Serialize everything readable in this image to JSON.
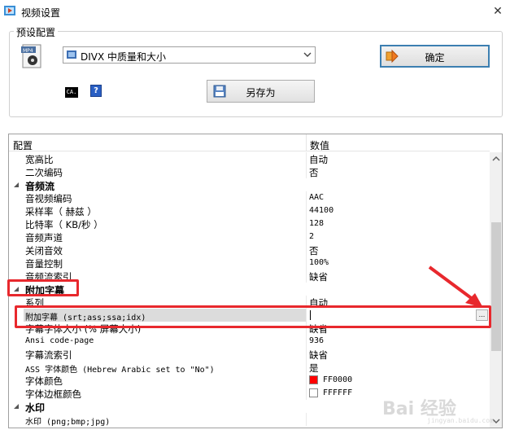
{
  "window": {
    "title": "视频设置",
    "close_glyph": "✕"
  },
  "preset": {
    "group_title": "预设配置",
    "selected_preset": "DIVX 中质量和大小",
    "ok_label": "确定",
    "saveas_label": "另存为",
    "cmd_label": "CA."
  },
  "grid": {
    "header_name": "配置",
    "header_value": "数值",
    "rows": [
      {
        "name": "宽高比",
        "value": "自动"
      },
      {
        "name": "二次编码",
        "value": "否"
      },
      {
        "name": "音频流",
        "category": true
      },
      {
        "name": "音视频编码",
        "value": "AAC"
      },
      {
        "name": "采样率（ 赫兹 ）",
        "value": "44100"
      },
      {
        "name": "比特率（ KB/秒 ）",
        "value": "128"
      },
      {
        "name": "音频声道",
        "value": "2"
      },
      {
        "name": "关闭音效",
        "value": "否"
      },
      {
        "name": "音量控制",
        "value": "100%"
      },
      {
        "name": "音频流索引",
        "value": "缺省"
      },
      {
        "name": "附加字幕",
        "category": true
      },
      {
        "name": "系列",
        "value": "自动"
      },
      {
        "name": "附加字幕 (srt;ass;ssa;idx)",
        "value": ""
      },
      {
        "name": "字幕字体大小 (% 屏幕大小)",
        "value": "缺省"
      },
      {
        "name": "Ansi code-page",
        "value": "936"
      },
      {
        "name": "字幕流索引",
        "value": "缺省"
      },
      {
        "name": "ASS 字体颜色 (Hebrew Arabic set to \"No\")",
        "value": "是"
      },
      {
        "name": "字体颜色",
        "value": "FF0000",
        "swatch": "#ff0000"
      },
      {
        "name": "字体边框颜色",
        "value": "FFFFFF",
        "swatch": "#ffffff"
      },
      {
        "name": "水印",
        "category": true
      },
      {
        "name": "水印 (png;bmp;jpg)",
        "value": ""
      }
    ]
  },
  "watermark": {
    "text": "Bai 经验",
    "sub": "jingyan.baidu.com"
  },
  "colors": {
    "highlight": "#e8282d",
    "ok_border": "#3c7fb1"
  }
}
